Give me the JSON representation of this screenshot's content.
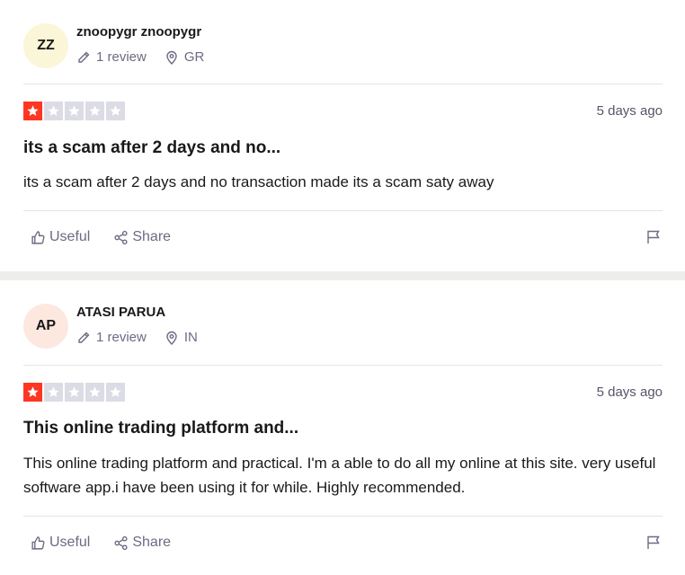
{
  "reviews": [
    {
      "initials": "ZZ",
      "name": "znoopygr znoopygr",
      "review_count": "1 review",
      "country": "GR",
      "rating": 1,
      "date": "5 days ago",
      "title": "its a scam after 2 days and no...",
      "body": "its a scam after 2 days and no transaction made its a scam saty away",
      "useful_label": "Useful",
      "share_label": "Share"
    },
    {
      "initials": "AP",
      "name": "ATASI PARUA",
      "review_count": "1 review",
      "country": "IN",
      "rating": 1,
      "date": "5 days ago",
      "title": "This online trading platform and...",
      "body": "This online trading platform and practical. I'm a able to do all my online at this site. very useful software app.i have been using it for while. Highly recommended.",
      "useful_label": "Useful",
      "share_label": "Share"
    }
  ],
  "colors": {
    "star_active": "#ff3722",
    "star_inactive": "#dcdce6",
    "avatar_1": "#faf6d7",
    "avatar_2": "#fde8e0"
  }
}
